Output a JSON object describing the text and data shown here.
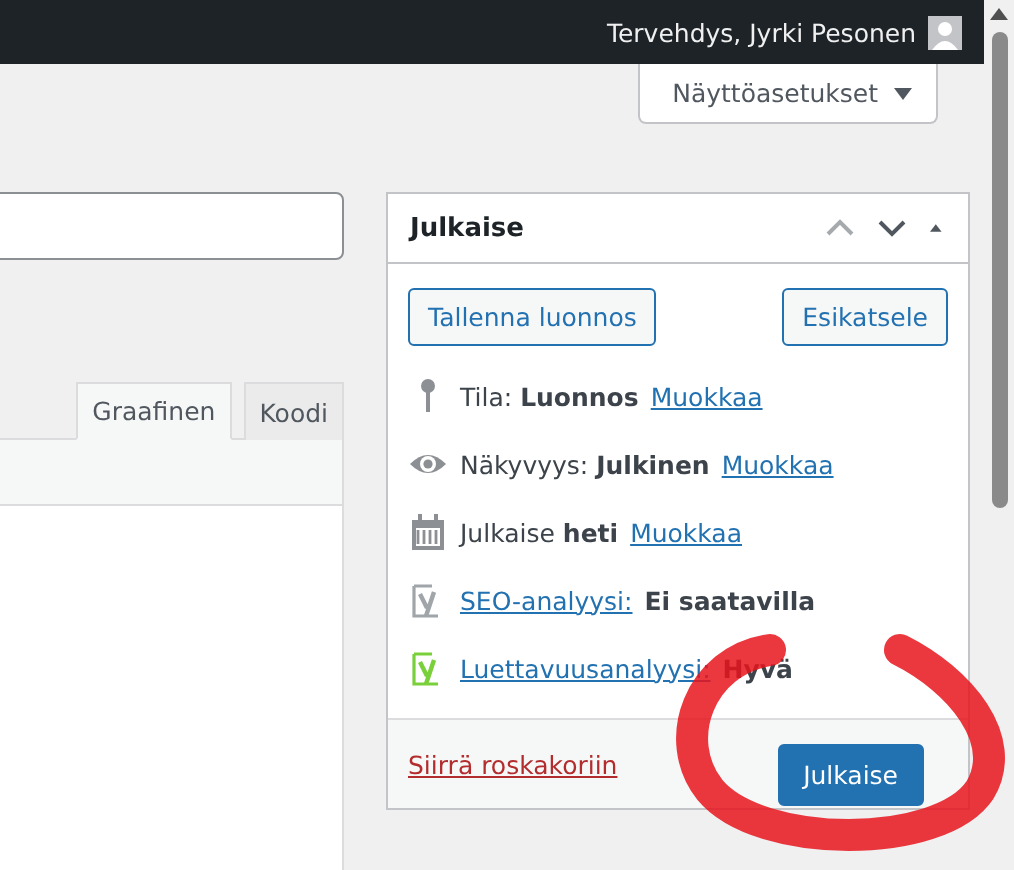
{
  "admin_bar": {
    "greeting": "Tervehdys, Jyrki Pesonen"
  },
  "screen_options": {
    "label": "Näyttöasetukset"
  },
  "editor": {
    "tabs": [
      {
        "label": "Graafinen",
        "selected": true
      },
      {
        "label": "Koodi",
        "selected": false
      }
    ]
  },
  "publish_box": {
    "title": "Julkaise",
    "buttons": [
      "Tallenna luonnos",
      "Esikatsele"
    ],
    "rows": [
      {
        "kind": "status",
        "label": "Tila:",
        "value": "Luonnos",
        "link": "Muokkaa"
      },
      {
        "kind": "visibility",
        "label": "Näkyvyys:",
        "value": "Julkinen",
        "link": "Muokkaa"
      },
      {
        "kind": "schedule",
        "label": "Julkaise",
        "value": "heti",
        "link": "Muokkaa"
      },
      {
        "kind": "analysis",
        "label": "SEO-analyysi:",
        "value": "Ei saatavilla",
        "color": "#a0a5aa"
      },
      {
        "kind": "analysis",
        "label": "Luettavuusanalyysi:",
        "value": "Hyvä",
        "color": "#7ad03a"
      }
    ],
    "trash_link": "Siirrä roskakoriin",
    "publish_button": "Julkaise"
  }
}
